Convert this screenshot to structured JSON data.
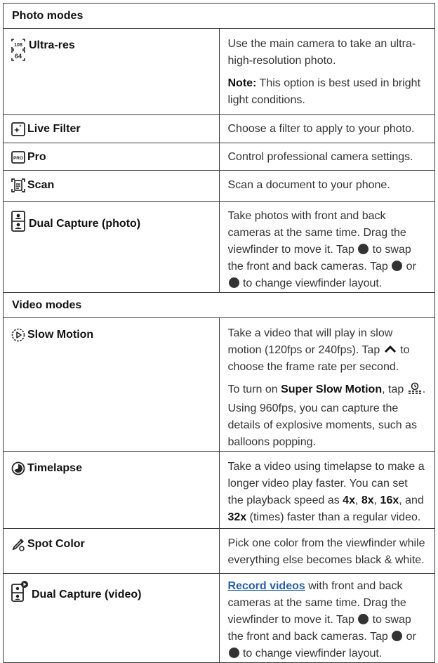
{
  "photo": {
    "header": "Photo modes",
    "ultra": {
      "label": "Ultra-res",
      "icon_badge_top": "108",
      "icon_badge_bottom": "64",
      "desc": "Use the main camera to take an ultra-high-resolution photo.",
      "note_label": "Note:",
      "note_text": " This option is best used in bright light conditions."
    },
    "live": {
      "label": "Live Filter",
      "desc": "Choose a filter to apply to your photo."
    },
    "pro": {
      "label": "Pro",
      "icon_text": "PRO",
      "desc": "Control professional camera settings."
    },
    "scan": {
      "label": "Scan",
      "desc": "Scan a document to your phone."
    },
    "dual": {
      "label": "Dual Capture (photo)",
      "d1": "Take photos with front and back cameras at the same time. Drag the viewfinder to move it.",
      "tap": "Tap ",
      "d2": " to swap the front and back cameras.",
      "or": " or ",
      "d3": " to change viewfinder layout."
    }
  },
  "video": {
    "header": "Video modes",
    "slow": {
      "label": "Slow Motion",
      "d1": "Take a video that will play in slow motion (120fps or 240fps). Tap ",
      "d2": " to choose the frame rate per second.",
      "d3": "To turn on ",
      "super": "Super Slow Motion",
      "d4": ", tap ",
      "d5": ". Using 960fps, you can capture the details of explosive moments, such as balloons popping."
    },
    "time": {
      "label": "Timelapse",
      "d1": "Take a video using timelapse to make a longer video play faster. You can set the playback speed as ",
      "s1": "4x",
      "c1": ", ",
      "s2": "8x",
      "c2": ", ",
      "s3": "16x",
      "c3": ", and ",
      "s4": "32x",
      "d2": " (times) faster than a regular video."
    },
    "spot": {
      "label": "Spot Color",
      "desc": "Pick one color from the viewfinder while everything else becomes black & white."
    },
    "dual": {
      "label": "Dual Capture (video)",
      "link": "Record videos",
      "d1": " with front and back cameras at the same time. Drag the viewfinder to move it.",
      "tap": "Tap ",
      "d2": " to swap the front and back cameras.",
      "or": " or ",
      "d3": " to change viewfinder layout."
    }
  }
}
